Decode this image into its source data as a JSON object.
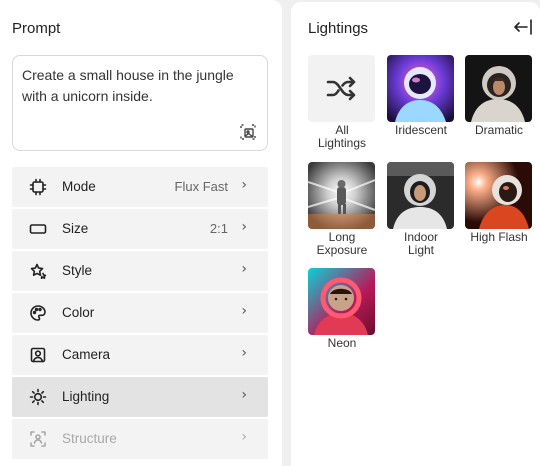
{
  "prompt_panel": {
    "title": "Prompt",
    "text": "Create a small house in the jungle with a unicorn inside."
  },
  "menu": [
    {
      "label": "Mode",
      "value": "Flux Fast",
      "icon": "chip-icon"
    },
    {
      "label": "Size",
      "value": "2:1",
      "icon": "rectangle-icon"
    },
    {
      "label": "Style",
      "value": "",
      "icon": "stars-icon"
    },
    {
      "label": "Color",
      "value": "",
      "icon": "palette-icon"
    },
    {
      "label": "Camera",
      "value": "",
      "icon": "camera-portrait-icon"
    },
    {
      "label": "Lighting",
      "value": "",
      "icon": "sun-icon",
      "active": true
    },
    {
      "label": "Structure",
      "value": "",
      "icon": "structure-icon",
      "disabled": true
    }
  ],
  "chevron": "›",
  "lightings_panel": {
    "title": "Lightings",
    "options": [
      {
        "label": "All\nLightings",
        "icon": "shuffle-icon"
      },
      {
        "label": "Iridescent"
      },
      {
        "label": "Dramatic"
      },
      {
        "label": "Long\nExposure"
      },
      {
        "label": "Indoor\nLight"
      },
      {
        "label": "High Flash"
      },
      {
        "label": "Neon"
      }
    ]
  },
  "colors": {
    "background": "#efefef",
    "panel": "#ffffff",
    "row": "#f3f3f3",
    "row_active": "#e3e3e3"
  }
}
